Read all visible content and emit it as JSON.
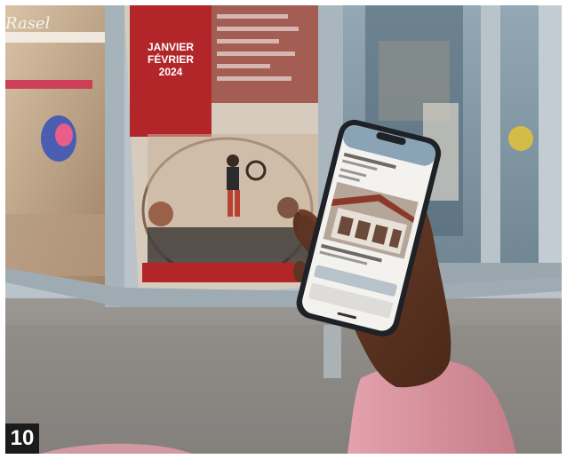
{
  "figure_number": "10",
  "scene": {
    "storefront_sign": "Rasel",
    "poster": {
      "month_line1": "JANVIER",
      "month_line2": "FÉVRIER",
      "year": "2024"
    }
  },
  "colors": {
    "poster_red": "#b2262a",
    "badge_bg": "#1b1b1b",
    "sleeve_pink": "#d8909b",
    "pavement": "#8e8b88",
    "glass": "#7f95a3"
  }
}
